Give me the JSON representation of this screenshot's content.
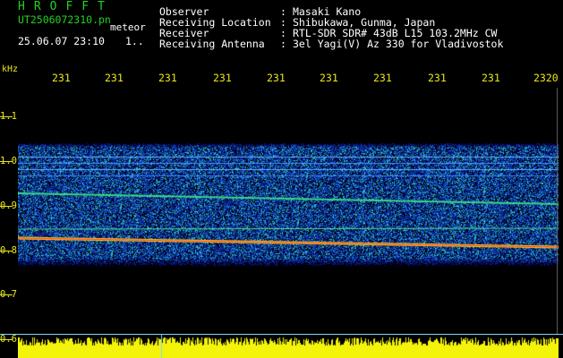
{
  "header": {
    "logo": "HROFFT",
    "filename": "UT2506072310.pn",
    "type": "meteor",
    "datetime": "25.06.07 23:10",
    "index": "1.."
  },
  "info": {
    "observer_label": "Observer",
    "observer_value": "Masaki Kano",
    "location_label": "Receiving Location",
    "location_value": "Shibukawa, Gunma, Japan",
    "receiver_label": "Receiver",
    "receiver_value": "RTL-SDR SDR# 43dB L15 103.2MHz CW",
    "antenna_label": "Receiving Antenna",
    "antenna_value": "3el Yagi(V) Az 330 for Vladivostok",
    "colon": ":"
  },
  "time_axis": {
    "labels": [
      "231",
      "231",
      "231",
      "231",
      "231",
      "231",
      "231",
      "231",
      "231",
      "2320"
    ]
  },
  "freq_axis": {
    "unit": "kHz",
    "ticks": [
      "1.1",
      "1.0",
      "0.9",
      "0.8",
      "0.7",
      "0.6"
    ]
  },
  "colors": {
    "accent_green": "#22d322",
    "axis_yellow": "#e8e81a",
    "text_white": "#ffffff",
    "background": "#000000"
  }
}
